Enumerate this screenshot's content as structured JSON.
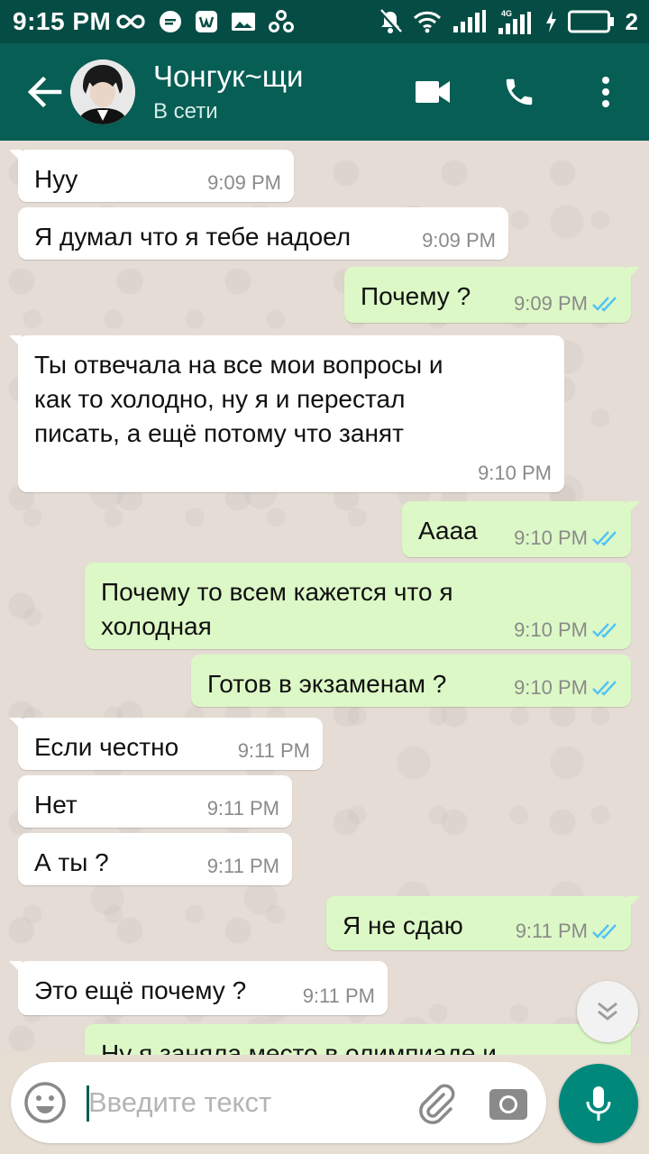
{
  "status_bar": {
    "time": "9:15 PM",
    "network_label": "4G",
    "battery_level": "2"
  },
  "header": {
    "contact_name": "Чонгук~щи",
    "contact_status": "В сети"
  },
  "messages": [
    {
      "dir": "in",
      "text": "Нуу",
      "time": "9:09 PM"
    },
    {
      "dir": "in",
      "text": "Я думал что я тебе надоел",
      "time": "9:09 PM"
    },
    {
      "dir": "out",
      "text": "Почему ?",
      "time": "9:09 PM",
      "read": true
    },
    {
      "dir": "in",
      "text": "Ты отвечала на все мои вопросы и\nкак то холодно, ну я и перестал\nписать, а ещё потому что занят",
      "time": "9:10 PM"
    },
    {
      "dir": "out",
      "text": "Аааа",
      "time": "9:10 PM",
      "read": true
    },
    {
      "dir": "out",
      "text": "Почему то всем кажется что я\nхолодная",
      "time": "9:10 PM",
      "read": true
    },
    {
      "dir": "out",
      "text": "Готов в экзаменам ?",
      "time": "9:10 PM",
      "read": true
    },
    {
      "dir": "in",
      "text": "Если честно",
      "time": "9:11 PM"
    },
    {
      "dir": "in",
      "text": "Нет",
      "time": "9:11 PM"
    },
    {
      "dir": "in",
      "text": "А ты ?",
      "time": "9:11 PM"
    },
    {
      "dir": "out",
      "text": "Я не сдаю",
      "time": "9:11 PM",
      "read": true
    },
    {
      "dir": "in",
      "text": "Это ещё почему ?",
      "time": "9:11 PM"
    },
    {
      "dir": "out",
      "text": "Ну я заняла место в олимпиаде и",
      "time": "",
      "read": false
    }
  ],
  "composer": {
    "placeholder": "Введите текст"
  },
  "colors": {
    "header": "#075e54",
    "status_bar": "#054d44",
    "outgoing_bubble": "#dcf8c6",
    "incoming_bubble": "#ffffff",
    "read_tick": "#4fc3f7",
    "mic_button": "#00897b"
  },
  "icons": [
    "back-arrow-icon",
    "video-call-icon",
    "voice-call-icon",
    "more-options-icon",
    "emoji-icon",
    "attach-icon",
    "camera-icon",
    "mic-icon",
    "scroll-down-icon"
  ]
}
